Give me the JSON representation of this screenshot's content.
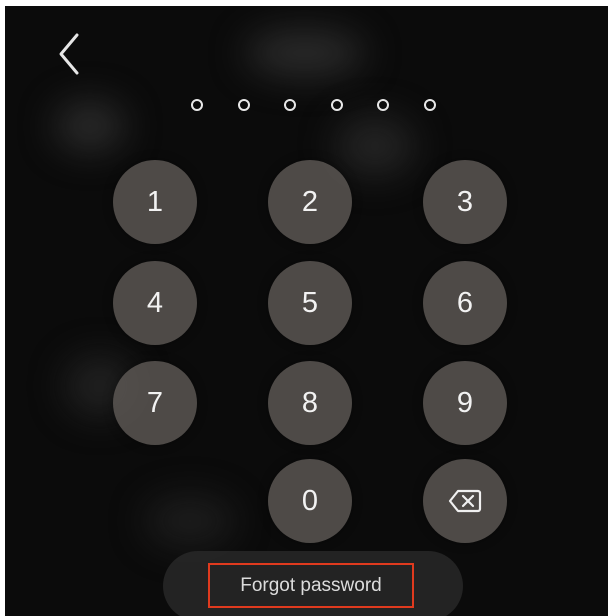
{
  "pin": {
    "dot_count": 6
  },
  "keypad": {
    "keys": [
      "1",
      "2",
      "3",
      "4",
      "5",
      "6",
      "7",
      "8",
      "9",
      "0"
    ]
  },
  "forgot": {
    "label": "Forgot password"
  },
  "colors": {
    "background": "#0b0b0b",
    "key_fill": "#625c58",
    "highlight_border": "#e03a1e"
  },
  "icons": {
    "back": "chevron-left-icon",
    "delete": "backspace-icon"
  }
}
